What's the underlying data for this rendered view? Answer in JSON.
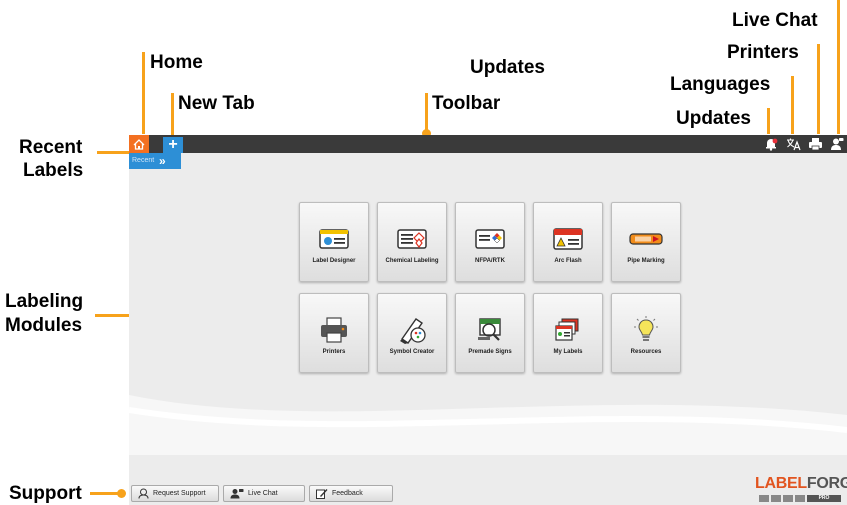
{
  "annotations": {
    "home": "Home",
    "new_tab": "New Tab",
    "updates_top": "Updates",
    "toolbar": "Toolbar",
    "live_chat": "Live Chat",
    "printers": "Printers",
    "languages": "Languages",
    "updates_right": "Updates",
    "recent_labels_line1": "Recent",
    "recent_labels_line2": "Labels",
    "labeling_line1": "Labeling",
    "labeling_line2": "Modules",
    "support": "Support"
  },
  "app": {
    "recent_tab_label": "Recent",
    "recent_tab_chevron": "»",
    "new_tab_symbol": "+",
    "modules": [
      {
        "label": "Label Designer",
        "icon": "label-designer-icon"
      },
      {
        "label": "Chemical Labeling",
        "icon": "chemical-labeling-icon"
      },
      {
        "label": "NFPA/RTK",
        "icon": "nfpa-rtk-icon"
      },
      {
        "label": "Arc Flash",
        "icon": "arc-flash-icon"
      },
      {
        "label": "Pipe Marking",
        "icon": "pipe-marking-icon"
      },
      {
        "label": "Printers",
        "icon": "printer-icon"
      },
      {
        "label": "Symbol Creator",
        "icon": "symbol-creator-icon"
      },
      {
        "label": "Premade Signs",
        "icon": "premade-signs-icon"
      },
      {
        "label": "My Labels",
        "icon": "my-labels-icon"
      },
      {
        "label": "Resources",
        "icon": "lightbulb-icon"
      }
    ],
    "support_buttons": [
      {
        "label": "Request Support",
        "icon": "support-agent-icon"
      },
      {
        "label": "Live Chat",
        "icon": "chat-icon"
      },
      {
        "label": "Feedback",
        "icon": "feedback-icon"
      }
    ],
    "logo_part1": "LABEL",
    "logo_part2": "FORGE",
    "logo_badge": "PRO"
  },
  "colors": {
    "annotation": "#f7a21b",
    "home": "#f37021",
    "accent_blue": "#2d8fd6",
    "toolbar": "#3a3a3a"
  }
}
